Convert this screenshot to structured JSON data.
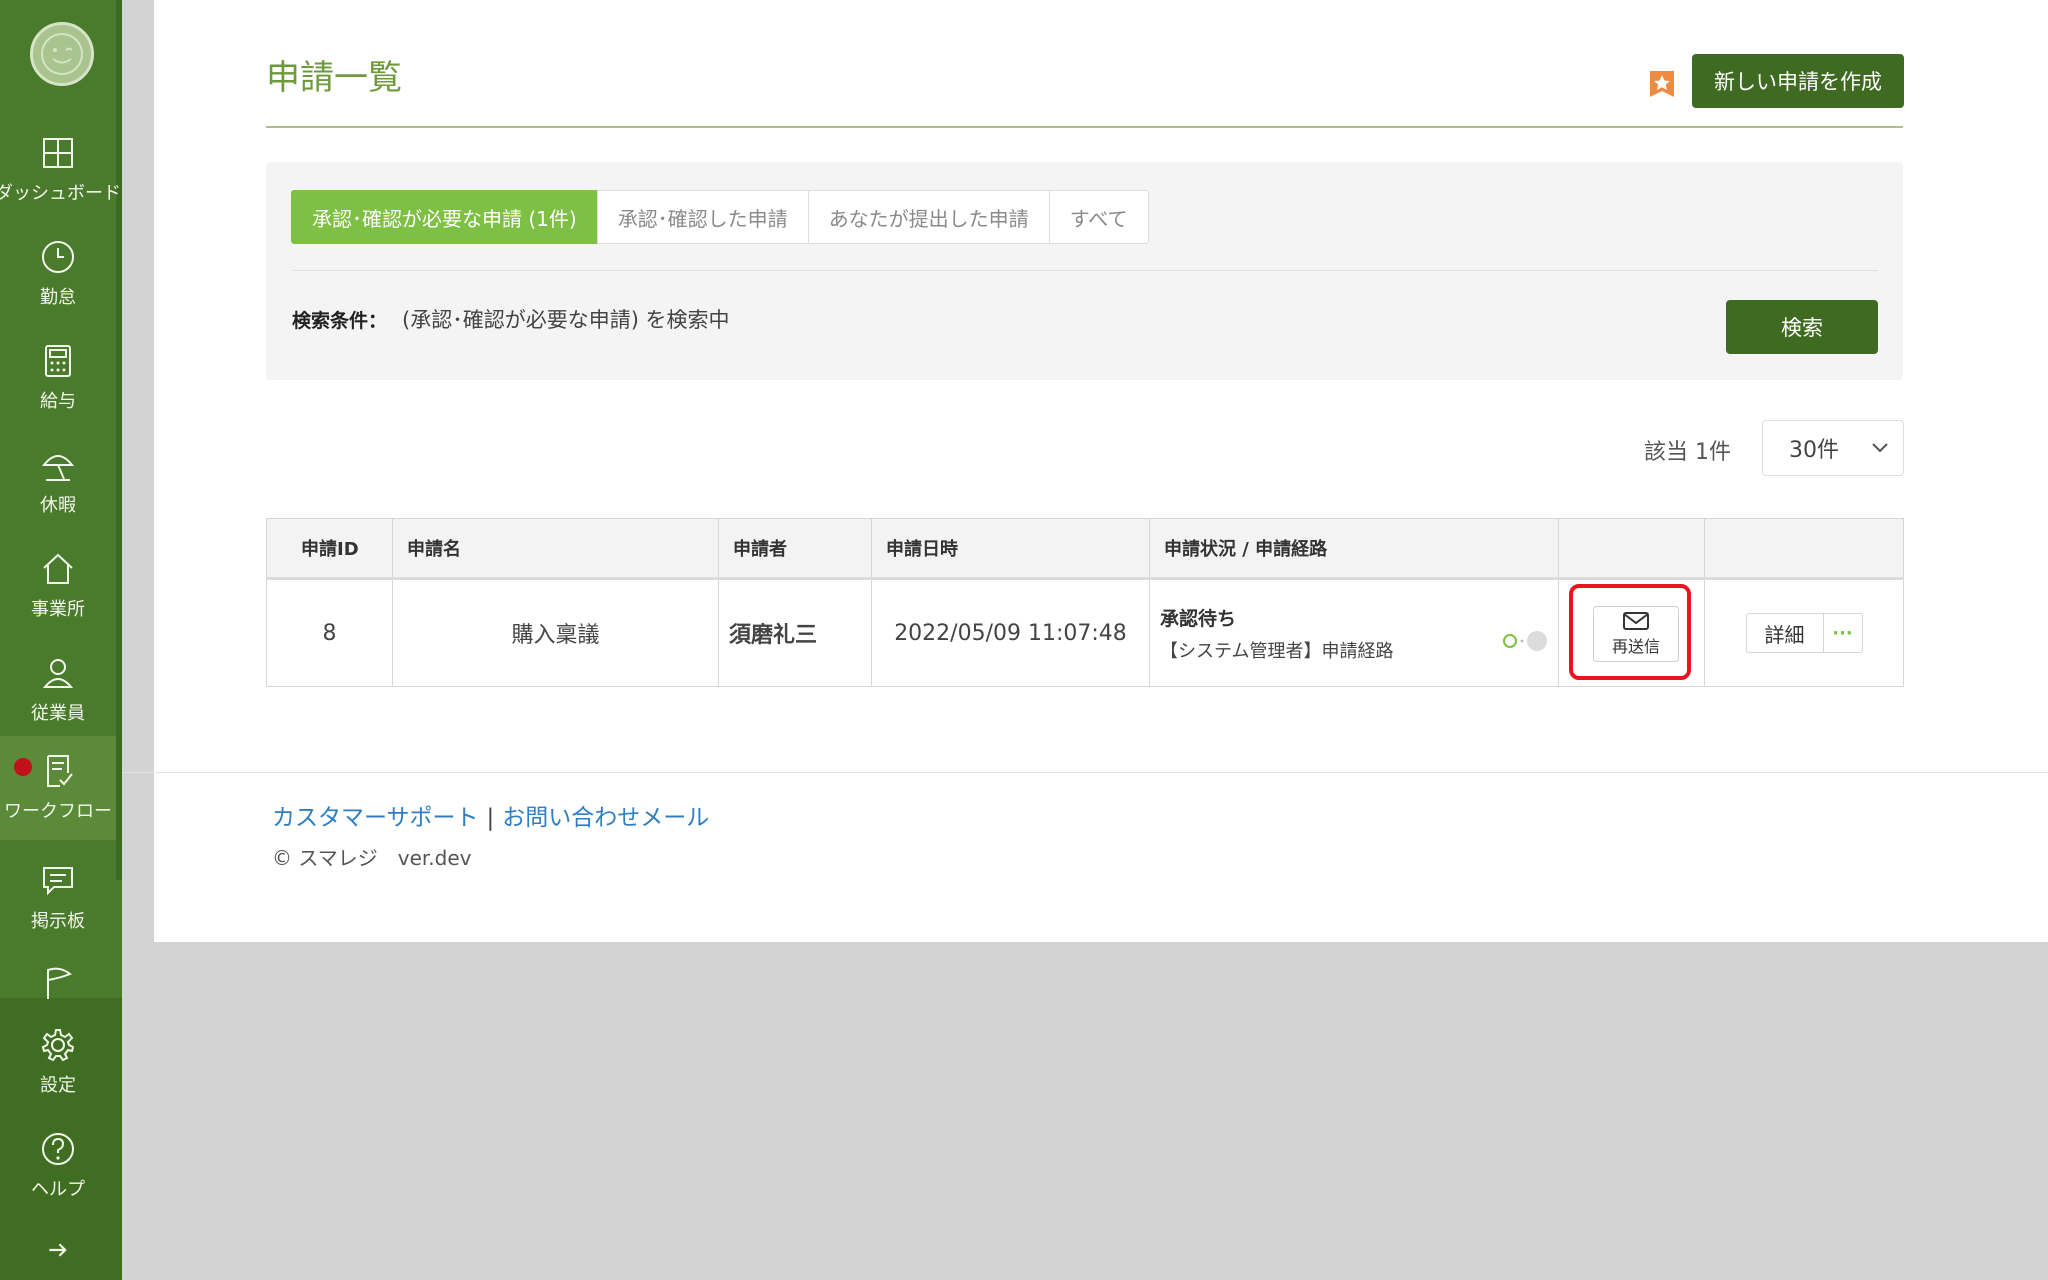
{
  "sidebar": {
    "items": [
      {
        "label": "ダッシュボード",
        "icon": "dashboard-icon"
      },
      {
        "label": "勤怠",
        "icon": "clock-icon"
      },
      {
        "label": "給与",
        "icon": "calculator-icon"
      },
      {
        "label": "休暇",
        "icon": "umbrella-icon"
      },
      {
        "label": "事業所",
        "icon": "home-icon"
      },
      {
        "label": "従業員",
        "icon": "person-icon"
      },
      {
        "label": "ワークフロー",
        "icon": "checklist-icon"
      },
      {
        "label": "掲示板",
        "icon": "chat-icon"
      },
      {
        "label": "",
        "icon": "flag-icon"
      },
      {
        "label": "設定",
        "icon": "gear-icon"
      },
      {
        "label": "ヘルプ",
        "icon": "help-icon"
      }
    ],
    "active_item": "ワークフロー"
  },
  "header": {
    "title": "申請一覧",
    "create_button": "新しい申請を作成"
  },
  "filter": {
    "tabs": [
      {
        "label": "承認･確認が必要な申請 (1件)",
        "active": true
      },
      {
        "label": "承認･確認した申請",
        "active": false
      },
      {
        "label": "あなたが提出した申請",
        "active": false
      },
      {
        "label": "すべて",
        "active": false
      }
    ],
    "condition_label": "検索条件：",
    "condition_value": "(承認･確認が必要な申請) を検索中",
    "search_button": "検索"
  },
  "results": {
    "count_text": "該当 1件",
    "per_page": "30件"
  },
  "table": {
    "headers": [
      "申請ID",
      "申請名",
      "申請者",
      "申請日時",
      "申請状況 / 申請経路",
      "",
      ""
    ],
    "rows": [
      {
        "id": "8",
        "name": "購入稟議",
        "applicant": "須磨礼三",
        "datetime": "2022/05/09 11:07:48",
        "status": "承認待ち",
        "route": "【システム管理者】申請経路",
        "resend_label": "再送信",
        "detail_label": "詳細",
        "more_label": "···"
      }
    ]
  },
  "footer": {
    "support_link": "カスタマーサポート",
    "separator": "|",
    "mail_link": "お問い合わせメール",
    "copyright": "© スマレジ　ver.dev"
  },
  "colors": {
    "sidebar": "#4a7a2b",
    "accent": "#7ec044",
    "primary_button": "#3f6a21",
    "title": "#6e9a3c",
    "highlight": "#e8141e"
  }
}
